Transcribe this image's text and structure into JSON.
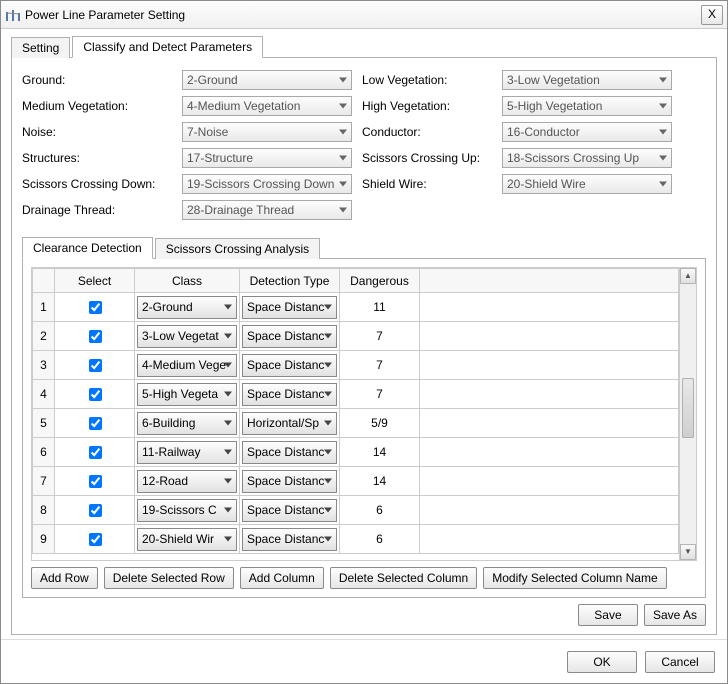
{
  "window": {
    "title": "Power Line Parameter Setting",
    "close": "X"
  },
  "outer_tabs": [
    {
      "label": "Setting",
      "active": false
    },
    {
      "label": "Classify and Detect Parameters",
      "active": true
    }
  ],
  "form": [
    {
      "label": "Ground:",
      "value": "2-Ground"
    },
    {
      "label": "Low Vegetation:",
      "value": "3-Low Vegetation"
    },
    {
      "label": "Medium Vegetation:",
      "value": "4-Medium Vegetation"
    },
    {
      "label": "High Vegetation:",
      "value": "5-High Vegetation"
    },
    {
      "label": "Noise:",
      "value": "7-Noise"
    },
    {
      "label": "Conductor:",
      "value": "16-Conductor"
    },
    {
      "label": "Structures:",
      "value": "17-Structure"
    },
    {
      "label": "Scissors Crossing Up:",
      "value": "18-Scissors Crossing Up"
    },
    {
      "label": "Scissors Crossing Down:",
      "value": "19-Scissors Crossing Down"
    },
    {
      "label": "Shield Wire:",
      "value": "20-Shield Wire"
    },
    {
      "label": "Drainage Thread:",
      "value": "28-Drainage Thread"
    }
  ],
  "inner_tabs": [
    {
      "label": "Clearance Detection",
      "active": true
    },
    {
      "label": "Scissors Crossing Analysis",
      "active": false
    }
  ],
  "table": {
    "columns": [
      "Select",
      "Class",
      "Detection Type",
      "Dangerous"
    ],
    "rows": [
      {
        "n": "1",
        "select": true,
        "class": "2-Ground",
        "dtype": "Space Distanc",
        "danger": "11"
      },
      {
        "n": "2",
        "select": true,
        "class": "3-Low Vegetat",
        "dtype": "Space Distanc",
        "danger": "7"
      },
      {
        "n": "3",
        "select": true,
        "class": "4-Medium Vege",
        "dtype": "Space Distanc",
        "danger": "7"
      },
      {
        "n": "4",
        "select": true,
        "class": "5-High Vegeta",
        "dtype": "Space Distanc",
        "danger": "7"
      },
      {
        "n": "5",
        "select": true,
        "class": "6-Building",
        "dtype": "Horizontal/Sp",
        "danger": "5/9"
      },
      {
        "n": "6",
        "select": true,
        "class": "11-Railway",
        "dtype": "Space Distanc",
        "danger": "14"
      },
      {
        "n": "7",
        "select": true,
        "class": "12-Road",
        "dtype": "Space Distanc",
        "danger": "14"
      },
      {
        "n": "8",
        "select": true,
        "class": "19-Scissors C",
        "dtype": "Space Distanc",
        "danger": "6"
      },
      {
        "n": "9",
        "select": true,
        "class": "20-Shield Wir",
        "dtype": "Space Distanc",
        "danger": "6"
      }
    ]
  },
  "row_buttons": {
    "add_row": "Add Row",
    "del_row": "Delete Selected Row",
    "add_col": "Add Column",
    "del_col": "Delete Selected Column",
    "mod_col": "Modify Selected Column Name"
  },
  "save_buttons": {
    "save": "Save",
    "save_as": "Save As"
  },
  "bottom_buttons": {
    "ok": "OK",
    "cancel": "Cancel"
  }
}
